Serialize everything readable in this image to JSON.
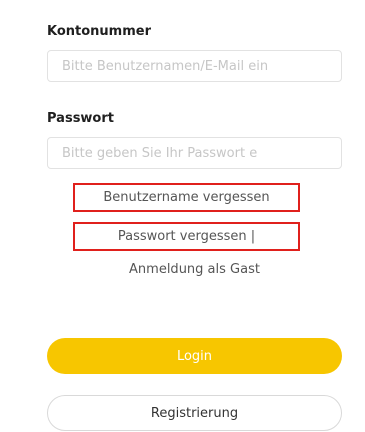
{
  "account": {
    "label": "Kontonummer",
    "placeholder": "Bitte Benutzernamen/E-Mail ein"
  },
  "password": {
    "label": "Passwort",
    "placeholder": "Bitte geben Sie Ihr Passwort e"
  },
  "links": {
    "forgot_username": "Benutzername vergessen",
    "forgot_password": "Passwort vergessen  |",
    "guest_login": "Anmeldung als Gast"
  },
  "buttons": {
    "login": "Login",
    "register": "Registrierung"
  },
  "colors": {
    "accent": "#f7c600",
    "highlight_border": "#e0201c"
  }
}
